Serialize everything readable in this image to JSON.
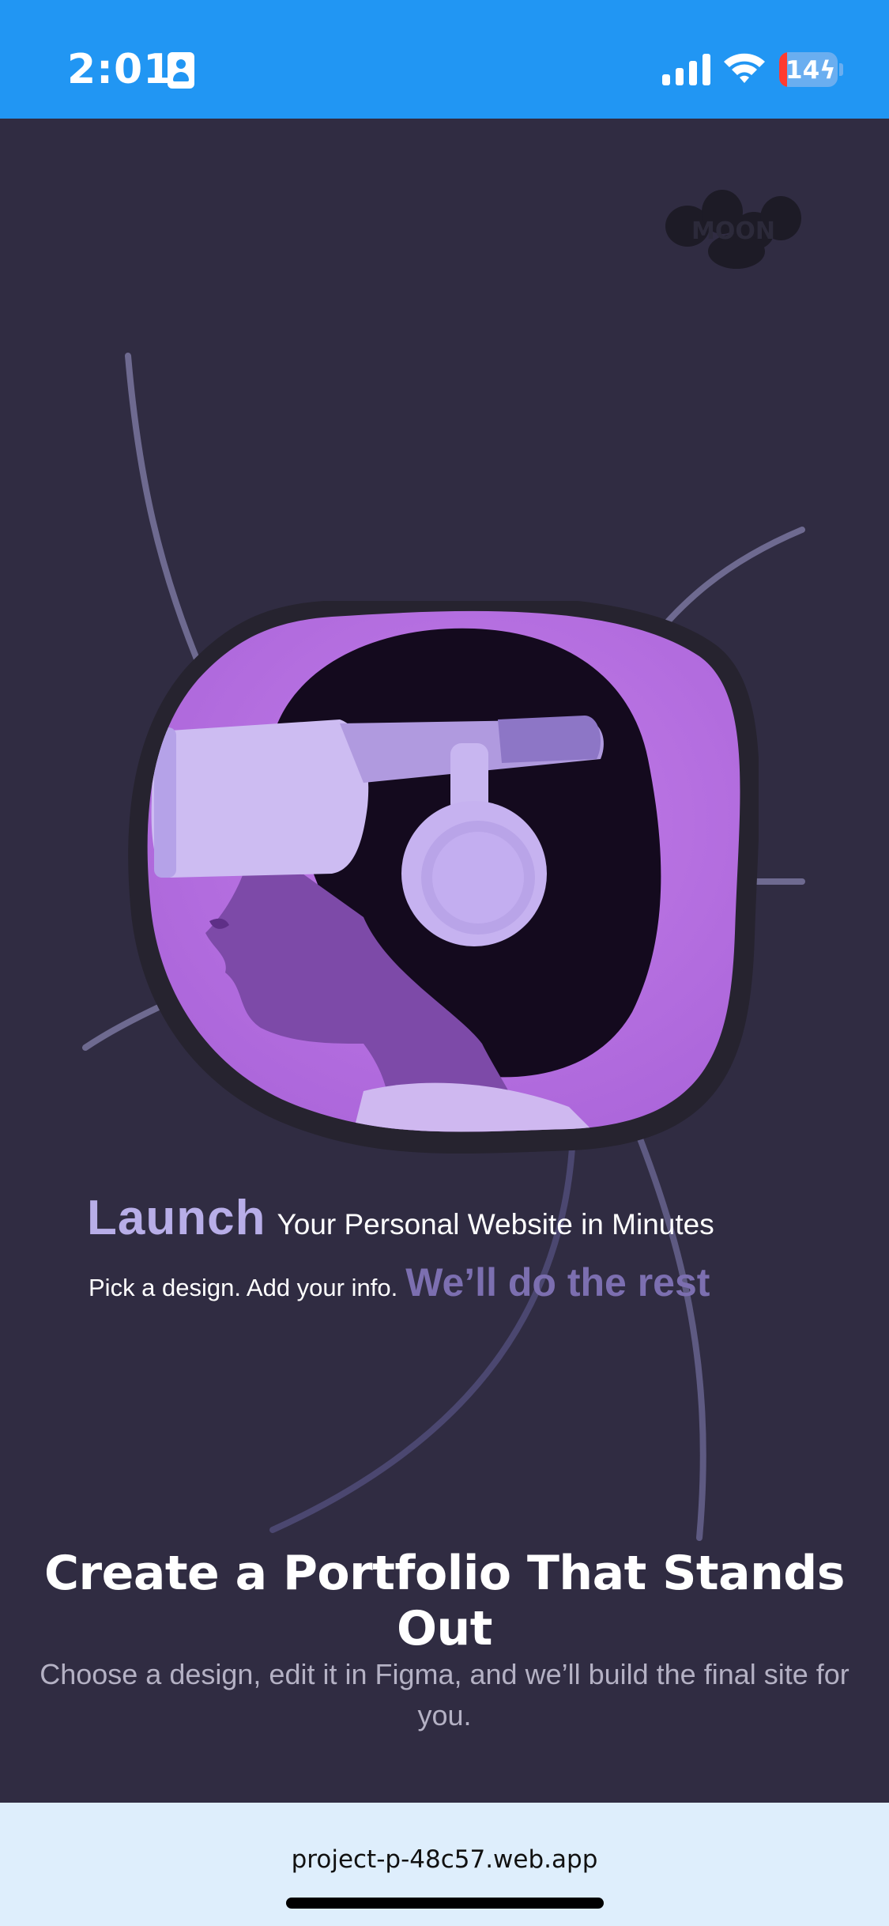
{
  "status_bar": {
    "time": "2:01",
    "battery_level": "14",
    "battery_fraction": 0.14,
    "icons": [
      "contact-card-icon",
      "cellular-signal-icon",
      "wifi-icon",
      "battery-charging-icon"
    ],
    "background_color": "#2196f3"
  },
  "hero": {
    "logo_text": "MOON",
    "image_subject": "person wearing VR headset and headphones",
    "accent_color": "#b06ad8"
  },
  "tagline": {
    "launch_word": "Launch",
    "launch_rest": "Your Personal Website in Minutes",
    "pick_text": "Pick a design. Add your info.",
    "rest_text": "We’ll do the rest"
  },
  "content": {
    "headline": "Create a Portfolio That Stands Out",
    "subhead": "Choose a design, edit it in Figma, and we’ll build the final site for you."
  },
  "browser": {
    "url": "project-p-48c57.web.app"
  },
  "colors": {
    "page_background": "#302c42",
    "launch_accent": "#b8aee8",
    "rest_accent": "#7c6fb0"
  }
}
